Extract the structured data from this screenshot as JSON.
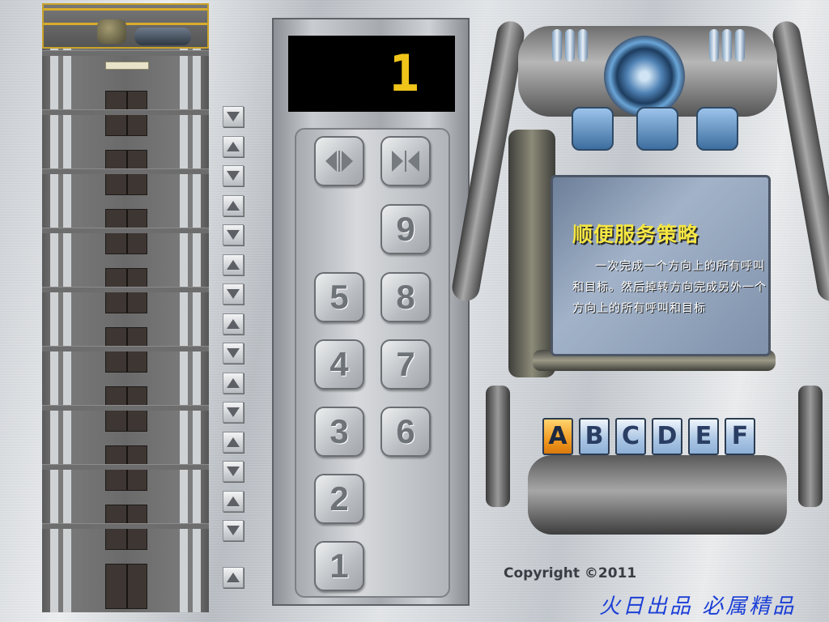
{
  "display": {
    "current_floor": "1"
  },
  "building": {
    "floor_count": 9
  },
  "hall_calls": [
    {
      "floor": 9,
      "dir": "down"
    },
    {
      "floor": 8,
      "dir": "up"
    },
    {
      "floor": 8,
      "dir": "down"
    },
    {
      "floor": 7,
      "dir": "up"
    },
    {
      "floor": 7,
      "dir": "down"
    },
    {
      "floor": 6,
      "dir": "up"
    },
    {
      "floor": 6,
      "dir": "down"
    },
    {
      "floor": 5,
      "dir": "up"
    },
    {
      "floor": 5,
      "dir": "down"
    },
    {
      "floor": 4,
      "dir": "up"
    },
    {
      "floor": 4,
      "dir": "down"
    },
    {
      "floor": 3,
      "dir": "up"
    },
    {
      "floor": 3,
      "dir": "down"
    },
    {
      "floor": 2,
      "dir": "up"
    },
    {
      "floor": 2,
      "dir": "down"
    },
    {
      "floor": 1,
      "dir": "up"
    }
  ],
  "car_keys": {
    "open_icon": "door-open-icon",
    "close_icon": "door-close-icon",
    "floors": [
      "1",
      "2",
      "3",
      "4",
      "5",
      "6",
      "7",
      "8",
      "9"
    ]
  },
  "strategy": {
    "title": "顺便服务策略",
    "description": "一次完成一个方向上的所有呼叫和目标。然后掉转方向完成另外一个方向上的所有呼叫和目标"
  },
  "strategy_buttons": {
    "labels": [
      "A",
      "B",
      "C",
      "D",
      "E",
      "F"
    ],
    "selected": "A"
  },
  "footer": {
    "copyright": "Copyright ©2011",
    "signature": "火日出品 必属精品"
  },
  "colors": {
    "display_digit": "#f0c419",
    "title": "#f5e642",
    "selected_button": "#f29a21",
    "signature": "#1b3fd6"
  }
}
